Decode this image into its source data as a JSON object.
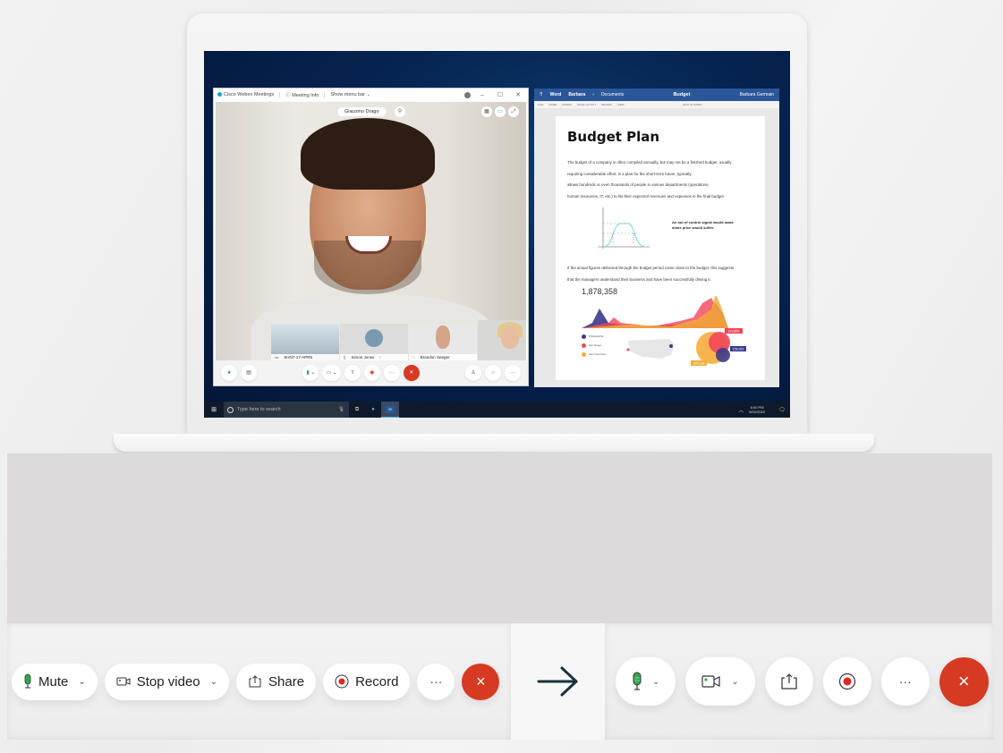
{
  "webex_window": {
    "app_name": "Cisco Webex Meetings",
    "meeting_info": "Meeting Info",
    "show_menu_bar": "Show menu bar",
    "active_speaker": "Giacomo Drago",
    "participants": [
      {
        "name": "SHN7-17-APR5"
      },
      {
        "name": "Simon Jones"
      },
      {
        "name": "Brandon Seeger"
      },
      {
        "name": ""
      }
    ]
  },
  "word_window": {
    "app": "Word",
    "breadcrumb": [
      "Barbara",
      "Documents"
    ],
    "doc_name": "Budget",
    "user": "Barbara Germain",
    "ribbon": [
      "FILE",
      "HOME",
      "INSERT",
      "PAGE LAYOUT",
      "REVIEW",
      "VIEW",
      "EDIT IN WORD"
    ],
    "doc_title": "Budget Plan",
    "para1": [
      "The budget of a company is often compiled annually, but may not be a finished budget, usually",
      "requiring considerable effort, is a plan for the short-term future, typically",
      "allows hundreds or even thousands of people in various departments (operations,",
      "human resources, IT, etc.) to list their expected revenues and expenses in the final budget."
    ],
    "quote": "An out of control signal would make share price would suffer.",
    "para2": [
      "If the actual figures delivered through the budget period come close to the budget, this suggests",
      "that the managers understand their business and have been successfully driving it."
    ],
    "stat_value": "1,878,358",
    "legend": [
      {
        "label": "Philadelphia",
        "color": "#3d3a8c"
      },
      {
        "label": "San Diego",
        "color": "#f2455a"
      },
      {
        "label": "San Francisco",
        "color": "#f6ac3b"
      }
    ],
    "bubble_labels": [
      "313,859",
      "158,329",
      "526,118"
    ]
  },
  "taskbar": {
    "search_placeholder": "Type here to search",
    "time": "6:00 PM",
    "date": "6/02/2020"
  },
  "old_toolbar": {
    "mute_label": "Mute",
    "stop_video_label": "Stop video",
    "share_label": "Share",
    "record_label": "Record",
    "more_label": "···",
    "end_label": "×"
  },
  "new_toolbar": {
    "more_label": "···",
    "end_label": "×"
  },
  "colors": {
    "end_red": "#d63a22",
    "mic_green": "#2faa4f",
    "record_red": "#e0281e",
    "word_blue": "#2b579a"
  }
}
